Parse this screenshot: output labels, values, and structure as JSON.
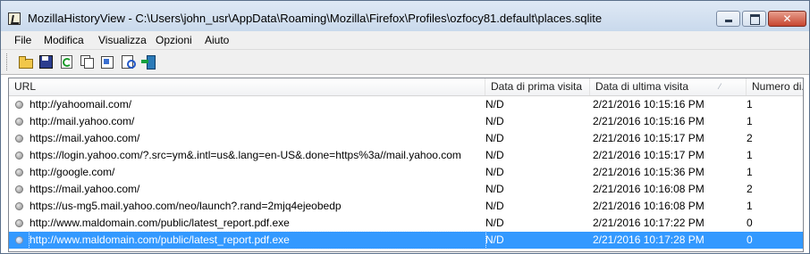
{
  "window": {
    "title": "MozillaHistoryView  -  C:\\Users\\john_usr\\AppData\\Roaming\\Mozilla\\Firefox\\Profiles\\ozfocy81.default\\places.sqlite",
    "close_glyph": "✕"
  },
  "menu": {
    "items": [
      "File",
      "Modifica",
      "Visualizza",
      "Opzioni",
      "Aiuto"
    ]
  },
  "toolbar": {
    "icons": [
      "open-folder-icon",
      "save-icon",
      "refresh-icon",
      "copy-icon",
      "properties-icon",
      "html-report-icon",
      "exit-icon"
    ]
  },
  "table": {
    "columns": [
      "URL",
      "Data di prima visita",
      "Data di ultima visita",
      "Numero di..."
    ],
    "sort_indicator": "⁄",
    "rows": [
      {
        "url": "http://yahoomail.com/",
        "first": "N/D",
        "last": "2/21/2016 10:15:16 PM",
        "count": "1"
      },
      {
        "url": "http://mail.yahoo.com/",
        "first": "N/D",
        "last": "2/21/2016 10:15:16 PM",
        "count": "1"
      },
      {
        "url": "https://mail.yahoo.com/",
        "first": "N/D",
        "last": "2/21/2016 10:15:17 PM",
        "count": "2"
      },
      {
        "url": "https://login.yahoo.com/?.src=ym&.intl=us&.lang=en-US&.done=https%3a//mail.yahoo.com",
        "first": "N/D",
        "last": "2/21/2016 10:15:17 PM",
        "count": "1"
      },
      {
        "url": "http://google.com/",
        "first": "N/D",
        "last": "2/21/2016 10:15:36 PM",
        "count": "1"
      },
      {
        "url": "https://mail.yahoo.com/",
        "first": "N/D",
        "last": "2/21/2016 10:16:08 PM",
        "count": "2"
      },
      {
        "url": "https://us-mg5.mail.yahoo.com/neo/launch?.rand=2mjq4ejeobedp",
        "first": "N/D",
        "last": "2/21/2016 10:16:08 PM",
        "count": "1"
      },
      {
        "url": "http://www.maldomain.com/public/latest_report.pdf.exe",
        "first": "N/D",
        "last": "2/21/2016 10:17:22 PM",
        "count": "0"
      },
      {
        "url": "http://www.maldomain.com/public/latest_report.pdf.exe",
        "first": "N/D",
        "last": "2/21/2016 10:17:28 PM",
        "count": "0",
        "selected": true
      }
    ]
  },
  "colors": {
    "selection": "#3399ff",
    "close_button": "#c6452f"
  }
}
